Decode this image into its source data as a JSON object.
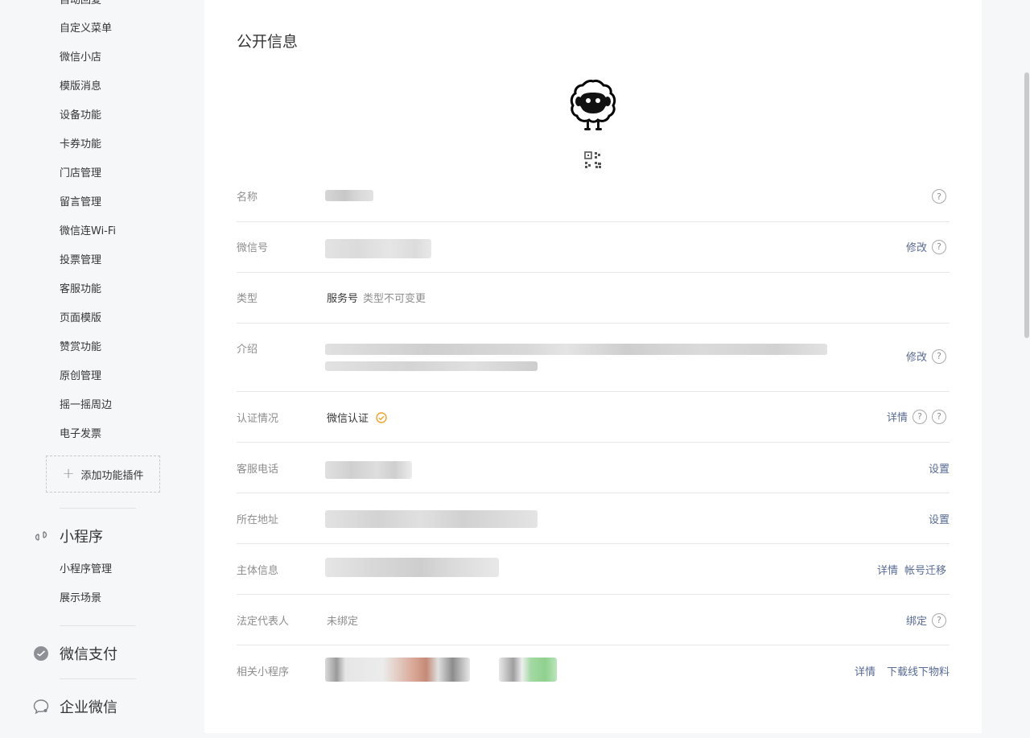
{
  "sidebar": {
    "partial_top": "自动回复",
    "items": [
      {
        "label": "自定义菜单"
      },
      {
        "label": "微信小店"
      },
      {
        "label": "模版消息"
      },
      {
        "label": "设备功能"
      },
      {
        "label": "卡券功能"
      },
      {
        "label": "门店管理"
      },
      {
        "label": "留言管理"
      },
      {
        "label": "微信连Wi-Fi"
      },
      {
        "label": "投票管理"
      },
      {
        "label": "客服功能"
      },
      {
        "label": "页面模版"
      },
      {
        "label": "赞赏功能"
      },
      {
        "label": "原创管理"
      },
      {
        "label": "摇一摇周边"
      },
      {
        "label": "电子发票"
      }
    ],
    "add_plugin": {
      "icon": "plus-icon",
      "label": "添加功能插件"
    },
    "mini_program": {
      "icon": "link-icon",
      "title": "小程序",
      "items": [
        {
          "label": "小程序管理"
        },
        {
          "label": "展示场景"
        }
      ]
    },
    "wechat_pay": {
      "icon": "wechat-pay-icon",
      "title": "微信支付"
    },
    "work_wechat": {
      "icon": "chat-bubble-icon",
      "title": "企业微信"
    }
  },
  "main": {
    "title": "公开信息",
    "avatar_icon": "sheep-avatar-icon",
    "qr_icon": "qr-code-icon",
    "rows": {
      "name": {
        "label": "名称"
      },
      "wechat_id": {
        "label": "微信号",
        "action": "修改"
      },
      "type": {
        "label": "类型",
        "value": "服务号",
        "note": "类型不可变更"
      },
      "intro": {
        "label": "介绍",
        "action": "修改"
      },
      "verification": {
        "label": "认证情况",
        "value": "微信认证",
        "action": "详情"
      },
      "phone": {
        "label": "客服电话",
        "action": "设置"
      },
      "address": {
        "label": "所在地址",
        "action": "设置"
      },
      "entity": {
        "label": "主体信息",
        "action_detail": "详情",
        "action_migrate": "帐号迁移"
      },
      "legal_rep": {
        "label": "法定代表人",
        "value": "未绑定",
        "action": "绑定"
      },
      "mini_programs": {
        "label": "相关小程序",
        "action_detail": "详情",
        "action_download": "下载线下物料"
      }
    },
    "help_glyph": "?"
  },
  "colors": {
    "link": "#576b95",
    "label": "#8d8d8d",
    "text": "#353535",
    "verified_badge": "#f0a229",
    "background": "#f6f7f9"
  }
}
